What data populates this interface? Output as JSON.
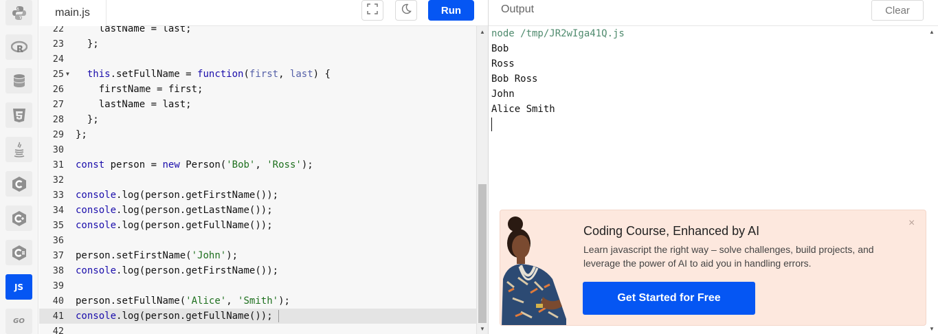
{
  "sidebar": {
    "languages": [
      {
        "name": "Python",
        "icon": "python-icon"
      },
      {
        "name": "R",
        "icon": "r-icon"
      },
      {
        "name": "SQL",
        "icon": "database-icon"
      },
      {
        "name": "HTML",
        "icon": "html5-icon"
      },
      {
        "name": "Java",
        "icon": "java-icon"
      },
      {
        "name": "C",
        "icon": "c-icon"
      },
      {
        "name": "C++",
        "icon": "cpp-icon"
      },
      {
        "name": "C#",
        "icon": "csharp-icon"
      },
      {
        "name": "JavaScript",
        "icon": "js-icon",
        "label": "JS",
        "active": true
      },
      {
        "name": "Go",
        "icon": "go-icon",
        "label": "GO"
      }
    ]
  },
  "editor": {
    "filename": "main.js",
    "run_label": "Run",
    "current_line": 41,
    "lines": [
      {
        "n": "22",
        "code": "    lastName = last;"
      },
      {
        "n": "23",
        "code": "  };"
      },
      {
        "n": "24",
        "code": ""
      },
      {
        "n": "25",
        "code": "  this.setFullName = function(first, last) {",
        "fold": true
      },
      {
        "n": "26",
        "code": "    firstName = first;"
      },
      {
        "n": "27",
        "code": "    lastName = last;"
      },
      {
        "n": "28",
        "code": "  };"
      },
      {
        "n": "29",
        "code": "};"
      },
      {
        "n": "30",
        "code": ""
      },
      {
        "n": "31",
        "code": "const person = new Person('Bob', 'Ross');"
      },
      {
        "n": "32",
        "code": ""
      },
      {
        "n": "33",
        "code": "console.log(person.getFirstName());"
      },
      {
        "n": "34",
        "code": "console.log(person.getLastName());"
      },
      {
        "n": "35",
        "code": "console.log(person.getFullName());"
      },
      {
        "n": "36",
        "code": ""
      },
      {
        "n": "37",
        "code": "person.setFirstName('John');"
      },
      {
        "n": "38",
        "code": "console.log(person.getFirstName());"
      },
      {
        "n": "39",
        "code": ""
      },
      {
        "n": "40",
        "code": "person.setFullName('Alice', 'Smith');"
      },
      {
        "n": "41",
        "code": "console.log(person.getFullName());"
      },
      {
        "n": "42",
        "code": ""
      }
    ]
  },
  "output": {
    "title": "Output",
    "clear_label": "Clear",
    "command": "node /tmp/JR2wIga41Q.js",
    "lines": [
      "Bob",
      "Ross",
      "Bob Ross",
      "John",
      "Alice Smith"
    ]
  },
  "ad": {
    "title": "Coding Course, Enhanced by AI",
    "description": "Learn javascript the right way – solve challenges, build projects, and leverage the power of AI to aid you in handling errors.",
    "cta": "Get Started for Free",
    "close": "×"
  },
  "colors": {
    "accent": "#0556f3",
    "ad_background": "#fde8de",
    "editor_background": "#f7f7f7"
  }
}
